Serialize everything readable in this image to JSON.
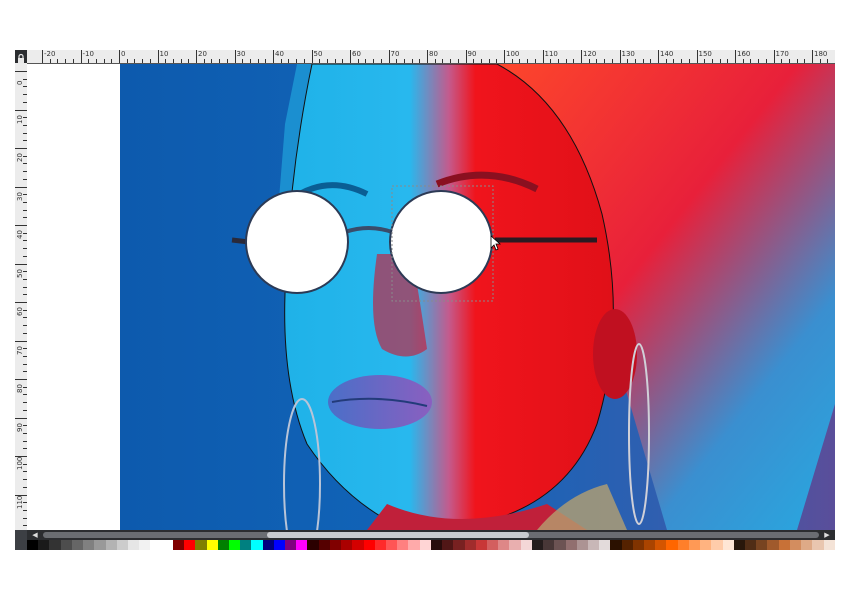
{
  "ruler": {
    "h_labels": [
      "-20",
      "-10",
      "0",
      "10",
      "20",
      "30",
      "40",
      "50",
      "60",
      "70",
      "80",
      "90",
      "100",
      "110",
      "120",
      "130",
      "140",
      "150",
      "160",
      "170",
      "180"
    ],
    "v_labels": [
      "0",
      "10",
      "20",
      "30",
      "40",
      "50",
      "60",
      "70",
      "80",
      "90",
      "100",
      "110",
      "120"
    ]
  },
  "scrollbar": {
    "left_arrow": "◀",
    "right_arrow": "▶"
  },
  "icons": {
    "lock": "lock-icon",
    "cursor": "move-cursor-icon"
  },
  "colors": {
    "ui_dark": "#3c3f44",
    "ruler": "#ececec",
    "photo_blue": "#1160b5",
    "photo_red": "#e8101a",
    "hair_cyan": "#2aa3d8"
  },
  "palette": [
    "#000000",
    "#1a1a1a",
    "#333333",
    "#4d4d4d",
    "#666666",
    "#808080",
    "#999999",
    "#b3b3b3",
    "#cccccc",
    "#e6e6e6",
    "#f2f2f2",
    "#ffffff",
    "#ffffff",
    "#800000",
    "#ff0000",
    "#808000",
    "#ffff00",
    "#008000",
    "#00ff00",
    "#008080",
    "#00ffff",
    "#000080",
    "#0000ff",
    "#800080",
    "#ff00ff",
    "#2b0000",
    "#550000",
    "#800000",
    "#aa0000",
    "#d40000",
    "#ff0000",
    "#ff2a2a",
    "#ff5555",
    "#ff8080",
    "#ffaaaa",
    "#ffd5d5",
    "#280b0b",
    "#501616",
    "#782121",
    "#a02c2c",
    "#c83737",
    "#d35f5f",
    "#de8787",
    "#e9afaf",
    "#f4d7d7",
    "#241c1c",
    "#483737",
    "#6c5353",
    "#916f6f",
    "#ac9393",
    "#c8b7b7",
    "#e3dbdb",
    "#2b1100",
    "#552200",
    "#803300",
    "#aa4400",
    "#d45500",
    "#ff6600",
    "#ff7f2a",
    "#ff9955",
    "#ffb380",
    "#ffccaa",
    "#ffe6d5",
    "#28170b",
    "#502d16",
    "#784421",
    "#a05a2c",
    "#c87137",
    "#d38d5f",
    "#deaa87",
    "#e9c6af",
    "#f4e3d7"
  ]
}
